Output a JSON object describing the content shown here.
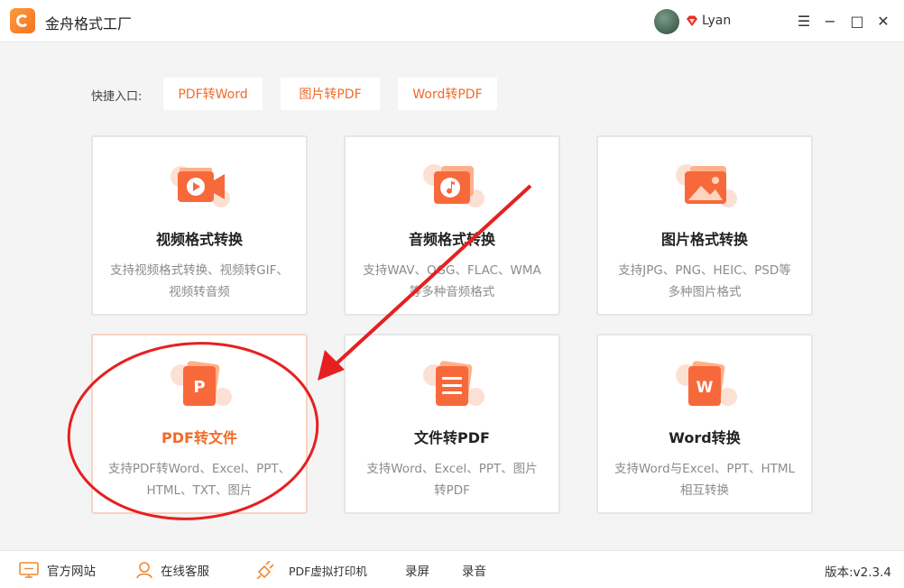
{
  "app": {
    "title": "金舟格式工厂"
  },
  "user": {
    "name": "Lyan"
  },
  "window_controls": {
    "menu": "☰",
    "minimize": "−",
    "maximize": "□",
    "close": "✕"
  },
  "quick_access": {
    "label": "快捷入口:",
    "buttons": [
      "PDF转Word",
      "图片转PDF",
      "Word转PDF"
    ]
  },
  "cards": [
    {
      "title": "视频格式转换",
      "desc1": "支持视频格式转换、视频转GIF、",
      "desc2": "视频转音频",
      "icon": "video-icon"
    },
    {
      "title": "音频格式转换",
      "desc1": "支持WAV、OGG、FLAC、WMA",
      "desc2": "等多种音频格式",
      "icon": "audio-icon"
    },
    {
      "title": "图片格式转换",
      "desc1": "支持JPG、PNG、HEIC、PSD等",
      "desc2": "多种图片格式",
      "icon": "image-icon"
    },
    {
      "title": "PDF转文件",
      "desc1": "支持PDF转Word、Excel、PPT、",
      "desc2": "HTML、TXT、图片",
      "icon": "pdf-p-icon",
      "selected": true
    },
    {
      "title": "文件转PDF",
      "desc1": "支持Word、Excel、PPT、图片",
      "desc2": "转PDF",
      "icon": "document-icon"
    },
    {
      "title": "Word转换",
      "desc1": "支持Word与Excel、PPT、HTML",
      "desc2": "相互转换",
      "icon": "word-w-icon"
    }
  ],
  "bottom": {
    "website": "官方网站",
    "support": "在线客服",
    "printer": "PDF虚拟打印机",
    "record_screen": "录屏",
    "record_audio": "录音",
    "version": "版本:v2.3.4"
  },
  "colors": {
    "accent": "#f26a2a",
    "annotation_red": "#e62020",
    "background": "#f4f4f4"
  }
}
